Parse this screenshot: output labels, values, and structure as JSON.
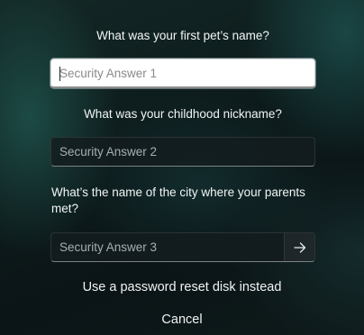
{
  "questions": [
    {
      "text": "What was your first pet’s name?",
      "placeholder": "Security Answer 1",
      "value": ""
    },
    {
      "text": "What was your childhood nickname?",
      "placeholder": "Security Answer 2",
      "value": ""
    },
    {
      "text": "What’s the name of the city where your parents met?",
      "placeholder": "Security Answer 3",
      "value": ""
    }
  ],
  "submit_icon": "arrow-right-icon",
  "reset_disk_link": "Use a password reset disk instead",
  "cancel_link": "Cancel"
}
